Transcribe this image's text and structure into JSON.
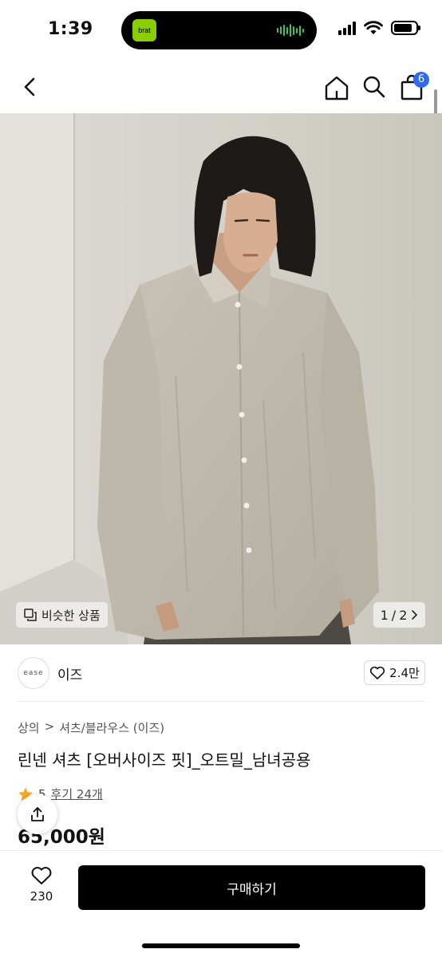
{
  "status_bar": {
    "time": "1:39",
    "island_app_label": "brat",
    "island_app_color": "#8ace00"
  },
  "nav": {
    "cart_count": "6",
    "badge_color": "#2f6bf0"
  },
  "hero": {
    "similar_label": "비슷한 상품",
    "page_current": "1",
    "page_separator": "/",
    "page_total": "2"
  },
  "brand": {
    "logo_text": "ease",
    "name": "이즈",
    "like_count": "2.4만"
  },
  "product": {
    "breadcrumb": [
      "상의",
      ">",
      "셔츠/블라우스 (이즈)"
    ],
    "title": "린넨 셔츠 [오버사이즈 핏]_오트밀_남녀공용",
    "rating": "5",
    "review_link": "후기 24개",
    "price": "65,000원",
    "rating_star_color": "#f5a623"
  },
  "bottom_bar": {
    "wish_count": "230",
    "buy_label": "구매하기"
  }
}
